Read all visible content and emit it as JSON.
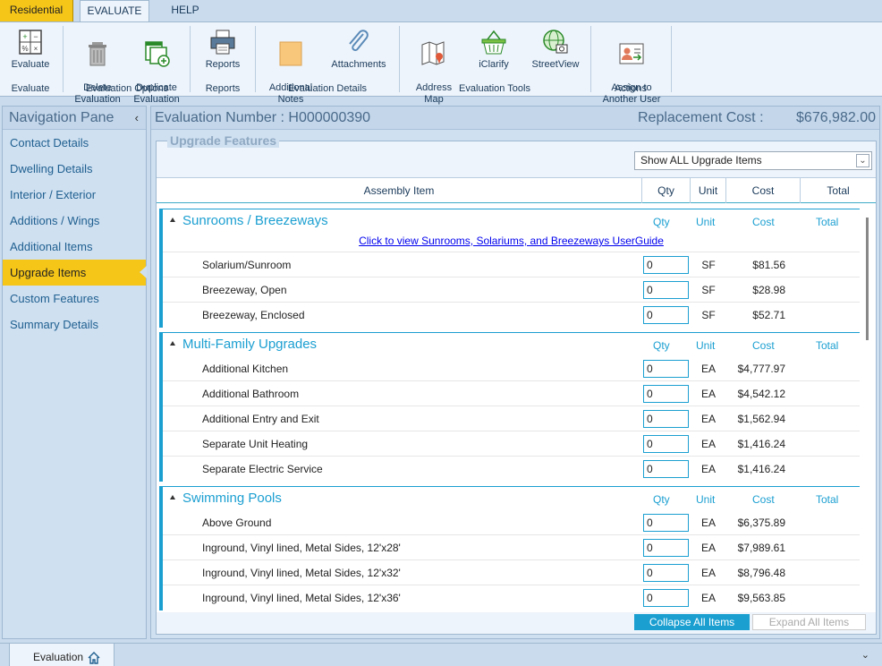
{
  "tabs": {
    "residential": "Residential",
    "evaluate": "EVALUATE",
    "help": "HELP"
  },
  "ribbon": {
    "evaluate": "Evaluate",
    "delete_eval": "Delete\nEvaluation",
    "duplicate_eval": "Duplicate\nEvaluation",
    "reports": "Reports",
    "additional_notes": "Additional\nNotes",
    "attachments": "Attachments",
    "address_map": "Address\nMap",
    "iclarify": "iClarify",
    "streetview": "StreetView",
    "assign": "Assign to\nAnother User",
    "groups": {
      "evaluate": "Evaluate",
      "evaluation_options": "Evaluation Options",
      "reports": "Reports",
      "evaluation_details": "Evaluation Details",
      "evaluation_tools": "Evaluation Tools",
      "actions": "Actions"
    }
  },
  "nav": {
    "title": "Navigation Pane",
    "items": [
      "Contact Details",
      "Dwelling Details",
      "Interior / Exterior",
      "Additions / Wings",
      "Additional Items",
      "Upgrade Items",
      "Custom Features",
      "Summary Details"
    ]
  },
  "header": {
    "evaluation_number": "Evaluation Number : H000000390",
    "replacement_label": "Replacement Cost :",
    "replacement_value": "$676,982.00"
  },
  "upgrade": {
    "legend": "Upgrade Features",
    "filter": "Show ALL Upgrade Items",
    "columns": {
      "assembly": "Assembly Item",
      "qty": "Qty",
      "unit": "Unit",
      "cost": "Cost",
      "total": "Total"
    },
    "groups": [
      {
        "title": "Sunrooms / Breezeways",
        "guide": "Click to view Sunrooms, Solariums, and Breezeways UserGuide",
        "rows": [
          {
            "name": "Solarium/Sunroom",
            "qty": "0",
            "unit": "SF",
            "cost": "$81.56"
          },
          {
            "name": "Breezeway, Open",
            "qty": "0",
            "unit": "SF",
            "cost": "$28.98"
          },
          {
            "name": "Breezeway, Enclosed",
            "qty": "0",
            "unit": "SF",
            "cost": "$52.71"
          }
        ]
      },
      {
        "title": "Multi-Family Upgrades",
        "rows": [
          {
            "name": "Additional Kitchen",
            "qty": "0",
            "unit": "EA",
            "cost": "$4,777.97"
          },
          {
            "name": "Additional Bathroom",
            "qty": "0",
            "unit": "EA",
            "cost": "$4,542.12"
          },
          {
            "name": "Additional Entry and Exit",
            "qty": "0",
            "unit": "EA",
            "cost": "$1,562.94"
          },
          {
            "name": "Separate Unit Heating",
            "qty": "0",
            "unit": "EA",
            "cost": "$1,416.24"
          },
          {
            "name": "Separate Electric Service",
            "qty": "0",
            "unit": "EA",
            "cost": "$1,416.24"
          }
        ]
      },
      {
        "title": "Swimming Pools",
        "rows": [
          {
            "name": "Above Ground",
            "qty": "0",
            "unit": "EA",
            "cost": "$6,375.89"
          },
          {
            "name": "Inground, Vinyl lined, Metal Sides, 12'x28'",
            "qty": "0",
            "unit": "EA",
            "cost": "$7,989.61"
          },
          {
            "name": "Inground, Vinyl lined, Metal Sides, 12'x32'",
            "qty": "0",
            "unit": "EA",
            "cost": "$8,796.48"
          },
          {
            "name": "Inground, Vinyl lined, Metal Sides, 12'x36'",
            "qty": "0",
            "unit": "EA",
            "cost": "$9,563.85"
          }
        ]
      }
    ],
    "collapse_all": "Collapse All Items",
    "expand_all": "Expand All Items"
  },
  "bottom_tab": "Evaluation"
}
